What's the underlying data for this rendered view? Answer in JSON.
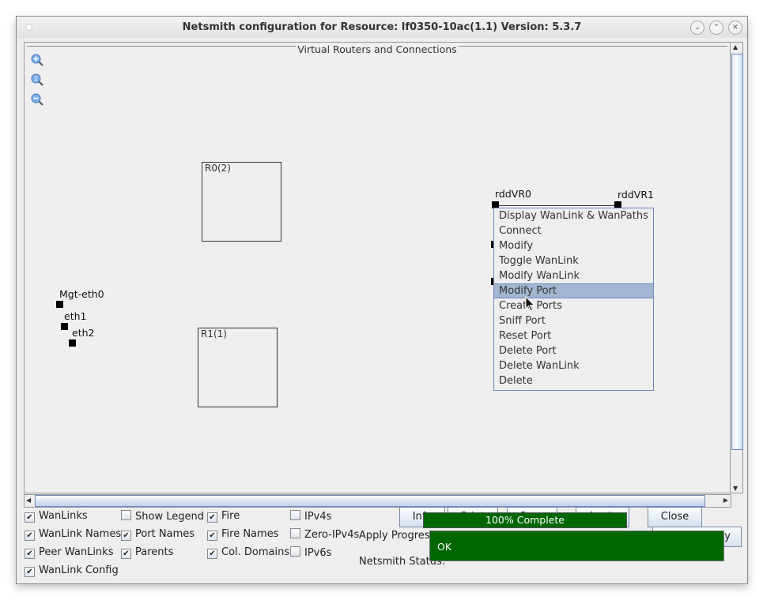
{
  "window": {
    "title": "Netsmith configuration for Resource:  lf0350-10ac(1.1)  Version: 5.3.7",
    "controls": [
      "minimize",
      "maximize",
      "close"
    ]
  },
  "canvas": {
    "group_title": "Virtual Routers and Connections",
    "zoom_tools": [
      "zoom-in",
      "zoom-reset",
      "zoom-out"
    ],
    "routers": [
      {
        "label": "R0(2)"
      },
      {
        "label": "R1(1)"
      }
    ],
    "ports": [
      {
        "label": "Mgt-eth0"
      },
      {
        "label": "eth1"
      },
      {
        "label": "eth2"
      }
    ],
    "wanlink": {
      "endpoint_a": "rddVR0",
      "endpoint_b": "rddVR1"
    }
  },
  "context_menu": {
    "selected": "Modify Port",
    "items": [
      "Display WanLink & WanPaths",
      "Connect",
      "Modify",
      "Toggle WanLink",
      "Modify WanLink",
      "Modify Port",
      "Create Ports",
      "Sniff Port",
      "Reset Port",
      "Delete Port",
      "Delete WanLink",
      "Delete"
    ]
  },
  "options": {
    "checkboxes": [
      {
        "label": "WanLinks",
        "checked": true
      },
      {
        "label": "Show Legend",
        "checked": false
      },
      {
        "label": "Fire",
        "checked": true
      },
      {
        "label": "IPv4s",
        "checked": false
      },
      {
        "label": "WanLink Names",
        "checked": true
      },
      {
        "label": "Port Names",
        "checked": true
      },
      {
        "label": "Fire Names",
        "checked": true
      },
      {
        "label": "Zero-IPv4s",
        "checked": false
      },
      {
        "label": "Peer WanLinks",
        "checked": true
      },
      {
        "label": "Parents",
        "checked": true
      },
      {
        "label": "Col. Domains",
        "checked": true
      },
      {
        "label": "IPv6s",
        "checked": false
      },
      {
        "label": "WanLink Config",
        "checked": true
      }
    ]
  },
  "buttons": {
    "info": "Info",
    "print": "Print",
    "sync": "Sync",
    "apply": "Apply",
    "close": "Close",
    "cancel_apply": "Cancel Apply"
  },
  "progress": {
    "label": "Apply Progress:",
    "value_percent": 100,
    "text": "100% Complete",
    "color": "#006600"
  },
  "status": {
    "label": "Netsmith Status:",
    "text": "OK",
    "color": "#006600"
  }
}
